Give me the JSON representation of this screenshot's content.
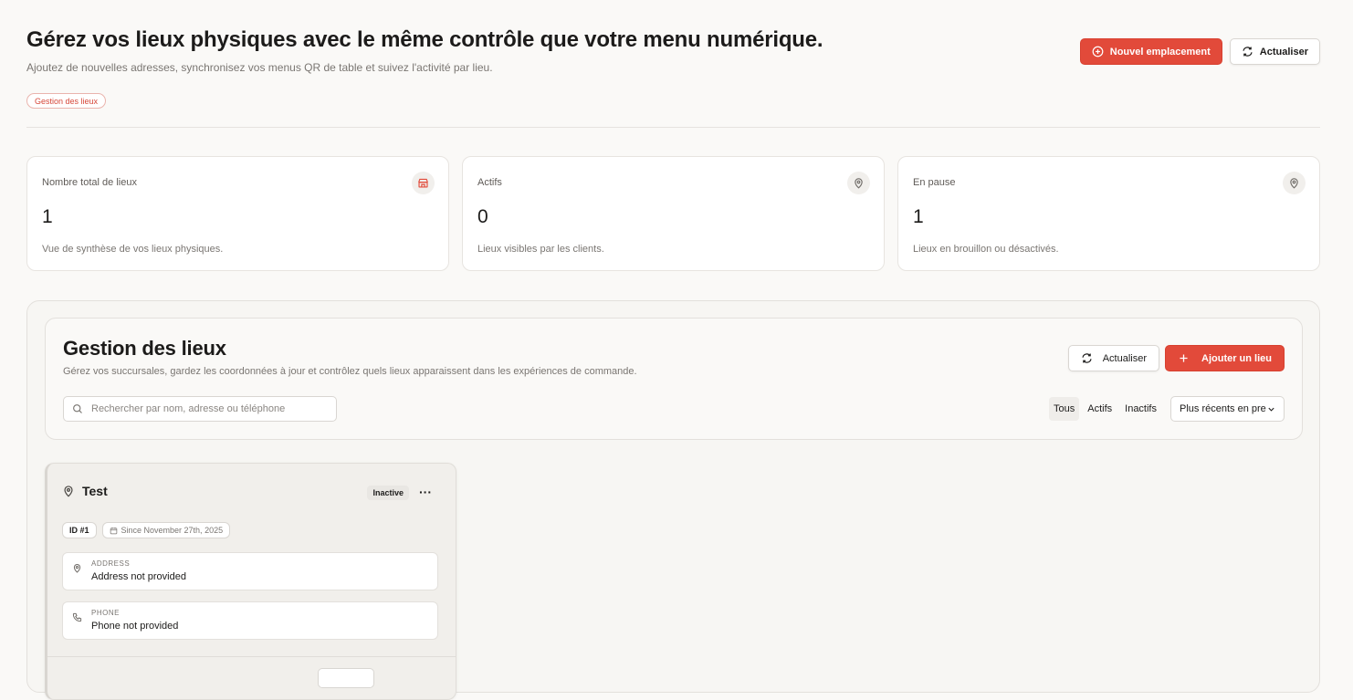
{
  "header": {
    "title": "Gérez vos lieux physiques avec le même contrôle que votre menu numérique.",
    "subtitle": "Ajoutez de nouvelles adresses, synchronisez vos menus QR de table et suivez l'activité par lieu.",
    "tag": "Gestion des lieux",
    "new_location_label": "Nouvel emplacement",
    "refresh_label": "Actualiser"
  },
  "stats": [
    {
      "label": "Nombre total de lieux",
      "value": "1",
      "description": "Vue de synthèse de vos lieux physiques.",
      "icon": "building-icon"
    },
    {
      "label": "Actifs",
      "value": "0",
      "description": "Lieux visibles par les clients.",
      "icon": "map-pin-icon"
    },
    {
      "label": "En pause",
      "value": "1",
      "description": "Lieux en brouillon ou désactivés.",
      "icon": "map-pin-icon"
    }
  ],
  "management": {
    "title": "Gestion des lieux",
    "subtitle": "Gérez vos succursales, gardez les coordonnées à jour et contrôlez quels lieux apparaissent dans les expériences de commande.",
    "refresh_label": "Actualiser",
    "add_label": "Ajouter un lieu",
    "search_placeholder": "Rechercher par nom, adresse ou téléphone",
    "filters": [
      "Tous",
      "Actifs",
      "Inactifs"
    ],
    "active_filter": "Tous",
    "sort_value": "Plus récents en premier"
  },
  "locations": [
    {
      "name": "Test",
      "status": "Inactive",
      "id_label": "ID #1",
      "since": "Since November 27th, 2025",
      "address_label": "ADDRESS",
      "address_value": "Address not provided",
      "phone_label": "PHONE",
      "phone_value": "Phone not provided"
    }
  ],
  "colors": {
    "accent": "#e24a3a",
    "background": "#faf9f7",
    "card": "#ffffff",
    "muted_text": "#7a7672"
  }
}
